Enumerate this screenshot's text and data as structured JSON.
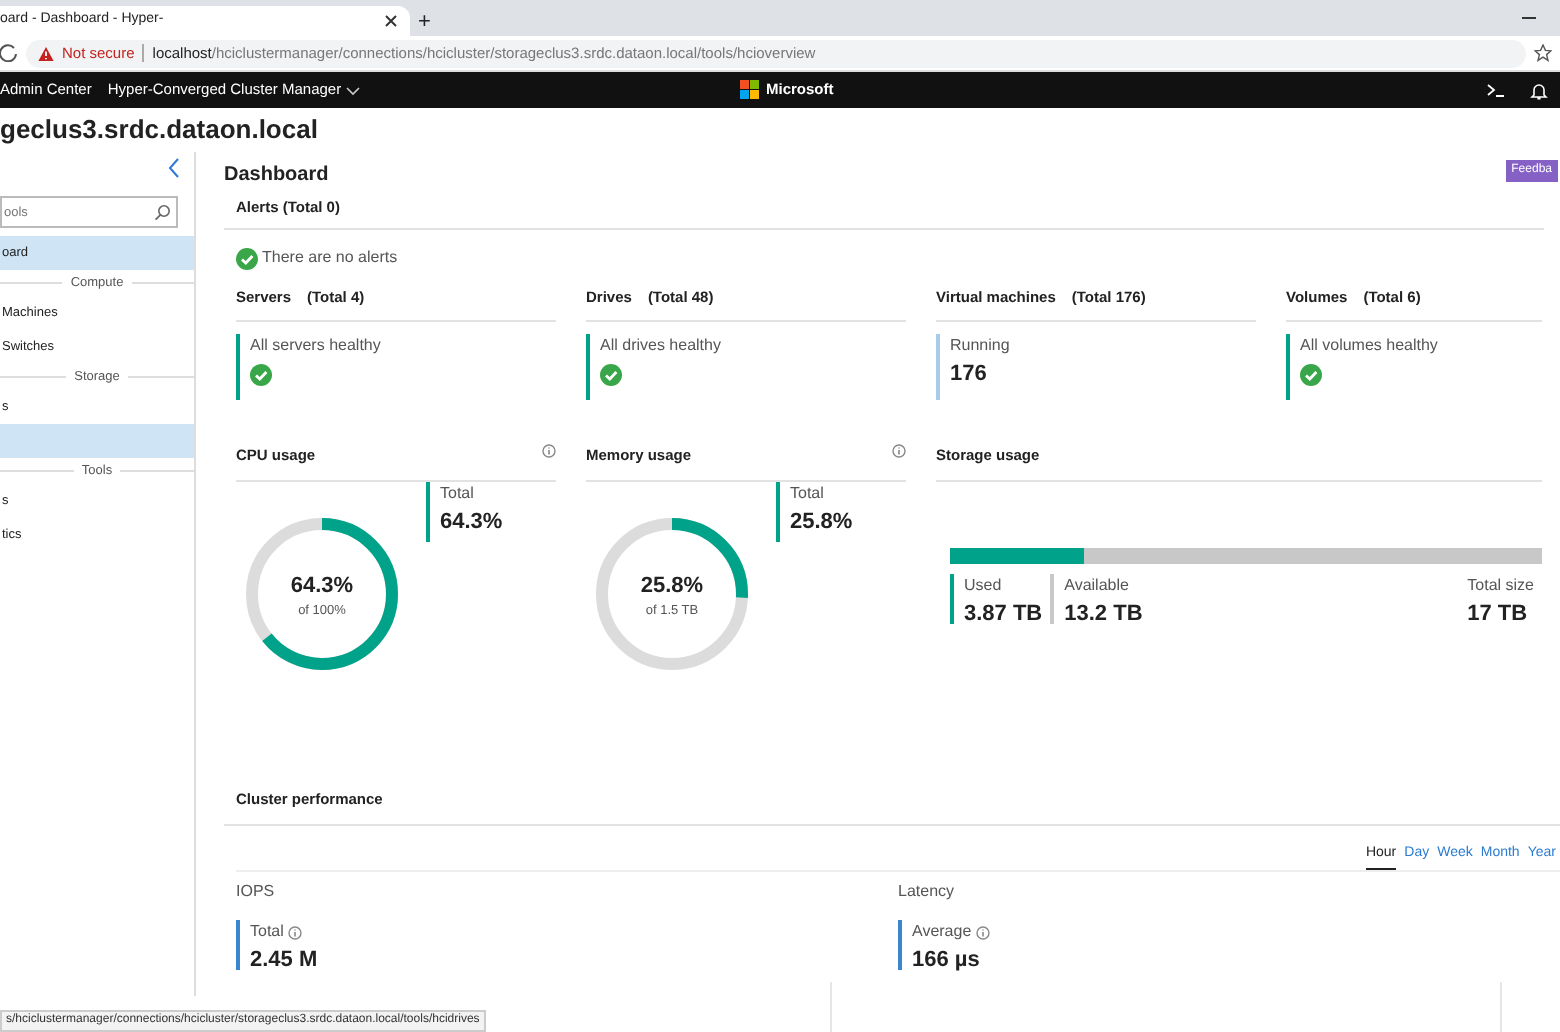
{
  "browser": {
    "tab_title": "oard - Dashboard - Hyper-",
    "new_tab": "+",
    "security": "Not secure",
    "url_host": "localhost",
    "url_path": "/hciclustermanager/connections/hcicluster/storageclus3.srdc.dataon.local/tools/hcioverview"
  },
  "app_header": {
    "product": "Admin Center",
    "tool": "Hyper-Converged Cluster Manager",
    "brand": "Microsoft"
  },
  "connection_title": "geclus3.srdc.dataon.local",
  "sidebar": {
    "search": {
      "placeholder": "ools"
    },
    "items": [
      {
        "kind": "item",
        "label": "oard",
        "selected": true
      },
      {
        "kind": "header",
        "label": "Compute"
      },
      {
        "kind": "item",
        "label": "Machines",
        "selected": false
      },
      {
        "kind": "item",
        "label": "Switches",
        "selected": false
      },
      {
        "kind": "header",
        "label": "Storage"
      },
      {
        "kind": "item",
        "label": "s",
        "selected": false
      },
      {
        "kind": "item",
        "selected": true
      },
      {
        "kind": "header",
        "label": "Tools"
      },
      {
        "kind": "item",
        "label": "s",
        "selected": false
      },
      {
        "kind": "item",
        "label": "tics",
        "selected": false
      }
    ]
  },
  "page_title": "Dashboard",
  "feedback_button": "Feedba",
  "alerts": {
    "title": "Alerts (Total 0)",
    "message": "There are no alerts"
  },
  "tiles": [
    {
      "kind": "healthy",
      "title": "Servers",
      "total": "(Total 4)",
      "status": "All servers healthy"
    },
    {
      "kind": "healthy",
      "title": "Drives",
      "total": "(Total 48)",
      "status": "All drives healthy"
    },
    {
      "kind": "count",
      "title": "Virtual machines",
      "total": "(Total 176)",
      "status": "Running",
      "value": "176"
    },
    {
      "kind": "healthy",
      "title": "Volumes",
      "total": "(Total 6)",
      "status": "All volumes healthy"
    }
  ],
  "usage": [
    {
      "title": "CPU usage",
      "center_value": "64.3%",
      "center_sub": "of 100%",
      "total_label": "Total",
      "total_value": "64.3%",
      "level": 0.643
    },
    {
      "title": "Memory usage",
      "center_value": "25.8%",
      "center_sub": "of 1.5 TB",
      "total_label": "Total",
      "total_value": "25.8%",
      "level": 0.258
    }
  ],
  "storage": {
    "title": "Storage usage",
    "level": 0.227,
    "stats": [
      {
        "label": "Used",
        "value": "3.87 TB",
        "color": "#00a389"
      },
      {
        "label": "Available",
        "value": "13.2 TB",
        "color": "#c8c8c8"
      },
      {
        "label": "Total size",
        "value": "17 TB"
      }
    ]
  },
  "performance": {
    "title": "Cluster performance",
    "ranges": [
      {
        "label": "Hour",
        "selected": true
      },
      {
        "label": "Day",
        "selected": false
      },
      {
        "label": "Week",
        "selected": false
      },
      {
        "label": "Month",
        "selected": false
      },
      {
        "label": "Year",
        "selected": false
      }
    ],
    "metrics": [
      {
        "title": "IOPS",
        "label": "Total",
        "value": "2.45 M"
      },
      {
        "title": "Latency",
        "label": "Average",
        "value": "166 µs"
      }
    ]
  },
  "status_url": "s/hciclustermanager/connections/hcicluster/storageclus3.srdc.dataon.local/tools/hcidrives"
}
